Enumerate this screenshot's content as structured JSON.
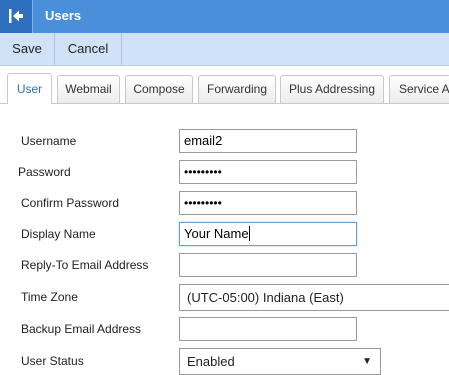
{
  "window": {
    "title": "Users"
  },
  "toolbar": {
    "save_label": "Save",
    "cancel_label": "Cancel"
  },
  "tabs": [
    {
      "label": "User",
      "active": true
    },
    {
      "label": "Webmail",
      "active": false
    },
    {
      "label": "Compose",
      "active": false
    },
    {
      "label": "Forwarding",
      "active": false
    },
    {
      "label": "Plus Addressing",
      "active": false
    },
    {
      "label": "Service A",
      "active": false
    }
  ],
  "form": {
    "username": {
      "label": "Username",
      "value": "email2"
    },
    "password": {
      "label": "Password",
      "value": "•••••••••"
    },
    "confirm_password": {
      "label": "Confirm Password",
      "value": "•••••••••"
    },
    "display_name": {
      "label": "Display Name",
      "value": "Your Name"
    },
    "reply_to": {
      "label": "Reply-To Email Address",
      "value": ""
    },
    "time_zone": {
      "label": "Time Zone",
      "value": "(UTC-05:00) Indiana (East)"
    },
    "backup_email": {
      "label": "Backup Email Address",
      "value": ""
    },
    "user_status": {
      "label": "User Status",
      "value": "Enabled"
    }
  },
  "colors": {
    "titlebar": "#4a8fd9",
    "toolbar": "#cfe2f6",
    "active_tab_text": "#2a6fc0"
  },
  "icons": {
    "back": "collapse-left-icon",
    "dropdown": "triangle-down-icon"
  }
}
